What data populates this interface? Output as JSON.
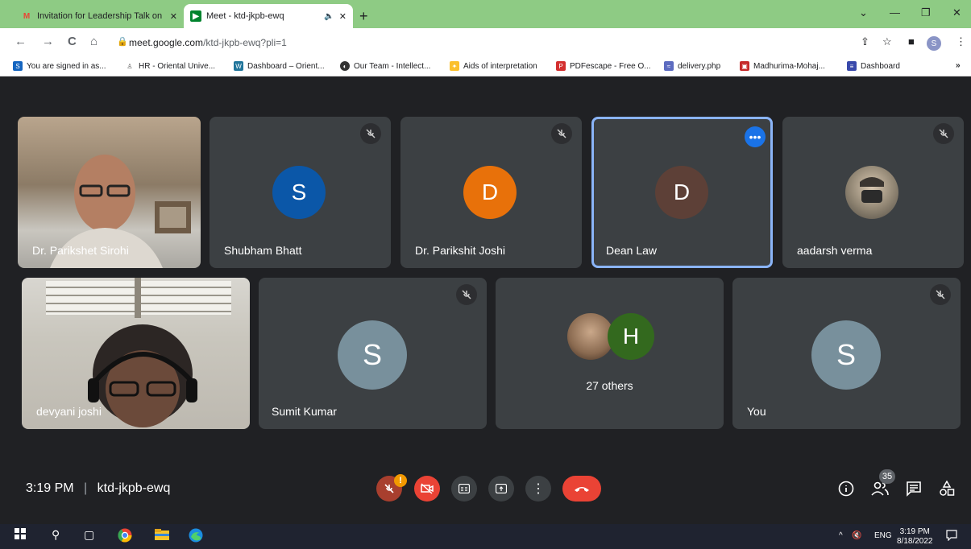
{
  "browser": {
    "tabs": [
      {
        "title": "Invitation for Leadership Talk on"
      },
      {
        "title": "Meet - ktd-jkpb-ewq"
      }
    ],
    "url_domain": "meet.google.com",
    "url_path": "/ktd-jkpb-ewq?pli=1",
    "profile_initial": "S",
    "bookmarks": [
      "You are signed in as...",
      "HR - Oriental Unive...",
      "Dashboard – Orient...",
      "Our Team - Intellect...",
      "Aids of interpretation",
      "PDFescape - Free O...",
      "delivery.php",
      "Madhurima-Mohaj...",
      "Dashboard"
    ]
  },
  "participants": [
    {
      "name": "Dr. Parikshet Sirohi"
    },
    {
      "name": "Shubham Bhatt",
      "initial": "S"
    },
    {
      "name": "Dr. Parikshit Joshi",
      "initial": "D"
    },
    {
      "name": "Dean Law",
      "initial": "D"
    },
    {
      "name": "aadarsh verma"
    },
    {
      "name": "devyani joshi"
    },
    {
      "name": "Sumit Kumar",
      "initial": "S"
    },
    {
      "name": "You",
      "initial": "S"
    }
  ],
  "others": {
    "initial": "H",
    "label": "27 others"
  },
  "meeting": {
    "time": "3:19 PM",
    "separator": "|",
    "code": "ktd-jkpb-ewq",
    "people_count": "35",
    "alert": "!"
  },
  "taskbar": {
    "time": "3:19 PM",
    "date": "8/18/2022",
    "lang": "ENG"
  },
  "colors": {
    "avatar_blue": "#0b57a8",
    "avatar_orange": "#e8710a",
    "avatar_brown": "#5d4037",
    "avatar_gray": "#78909c",
    "avatar_green": "#33691e",
    "selected_border": "#8ab4f8"
  }
}
